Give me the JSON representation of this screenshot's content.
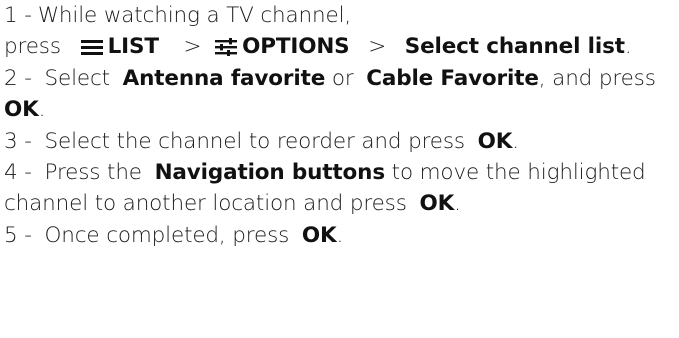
{
  "steps": [
    {
      "number": "1 -",
      "text_1": "While watching a TV channel,",
      "text_2": "press",
      "list_label": "LIST",
      "sep_1": ">",
      "options_label": "OPTIONS",
      "sep_2": ">",
      "select_channel_list": "Select channel list",
      "end": "."
    },
    {
      "number": "2 -",
      "text_1": "Select",
      "antenna_favorite": "Antenna favorite",
      "text_or": "or",
      "cable_favorite": "Cable Favorite",
      "text_2": ", and press",
      "ok": "OK",
      "end": "."
    },
    {
      "number": "3 -",
      "text_1": "Select the channel to reorder and press",
      "ok": "OK",
      "end": "."
    },
    {
      "number": "4 -",
      "text_1": "Press the",
      "navigation_buttons": "Navigation buttons",
      "text_2": "to move the highlighted channel to another location and press",
      "ok": "OK",
      "end": "."
    },
    {
      "number": "5 -",
      "text_1": "Once completed, press",
      "ok": "OK",
      "end": "."
    }
  ],
  "icons": {
    "list": "list-icon",
    "options": "options-icon"
  }
}
